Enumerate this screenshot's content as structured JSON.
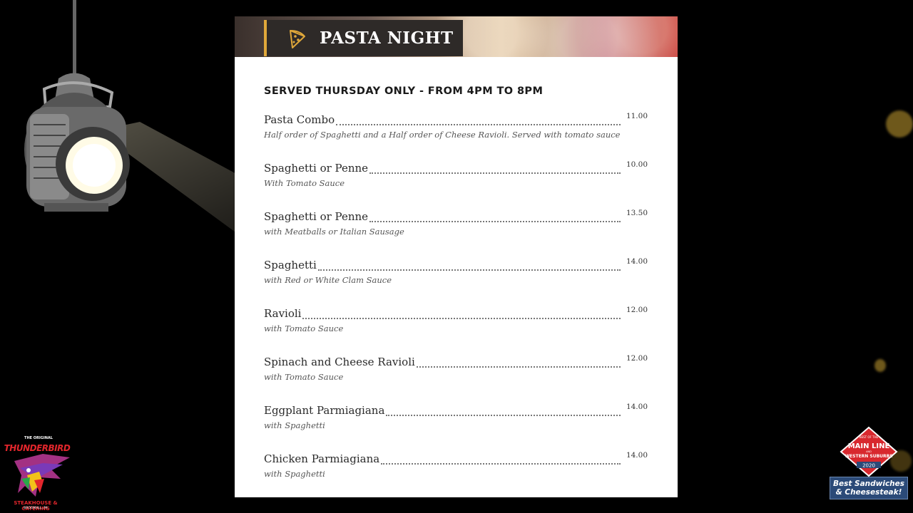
{
  "menu": {
    "title": "PASTA NIGHT",
    "icon": "pizza-slice-icon",
    "subtitle": "SERVED THURSDAY ONLY - FROM 4PM TO 8PM",
    "items": [
      {
        "name": "Pasta Combo",
        "price": "11.00",
        "desc": "Half order of Spaghetti and a Half order of Cheese Ravioli. Served with tomato sauce"
      },
      {
        "name": "Spaghetti or Penne",
        "price": "10.00",
        "desc": "With Tomato Sauce"
      },
      {
        "name": "Spaghetti or Penne",
        "price": "13.50",
        "desc": "with Meatballs or Italian Sausage"
      },
      {
        "name": "Spaghetti",
        "price": "14.00",
        "desc": "with Red or White Clam Sauce"
      },
      {
        "name": "Ravioli",
        "price": "12.00",
        "desc": "with Tomato Sauce"
      },
      {
        "name": "Spinach and Cheese Ravioli",
        "price": "12.00",
        "desc": "with Tomato Sauce"
      },
      {
        "name": "Eggplant Parmiagiana",
        "price": "14.00",
        "desc": "with Spaghetti"
      },
      {
        "name": "Chicken Parmiagiana",
        "price": "14.00",
        "desc": "with Spaghetti"
      }
    ]
  },
  "logos": {
    "thunderbird": {
      "top": "THE ORIGINAL",
      "name": "THUNDERBIRD",
      "sub": "STEAKHOUSE & CATERING",
      "location": "BROOMALL, PA"
    },
    "main_line": {
      "top": "BEST OF THE",
      "name_1": "MAIN LINE",
      "and": "AND",
      "name_2": "WESTERN SUBURBS",
      "year": "2020",
      "caption_1": "Best Sandwiches",
      "caption_2": "& Cheesesteak!"
    }
  },
  "colors": {
    "accent": "#e0a83a",
    "title_bg": "#2e2a28",
    "badge_red": "#d8282e",
    "caption_blue": "#2b4a78"
  }
}
